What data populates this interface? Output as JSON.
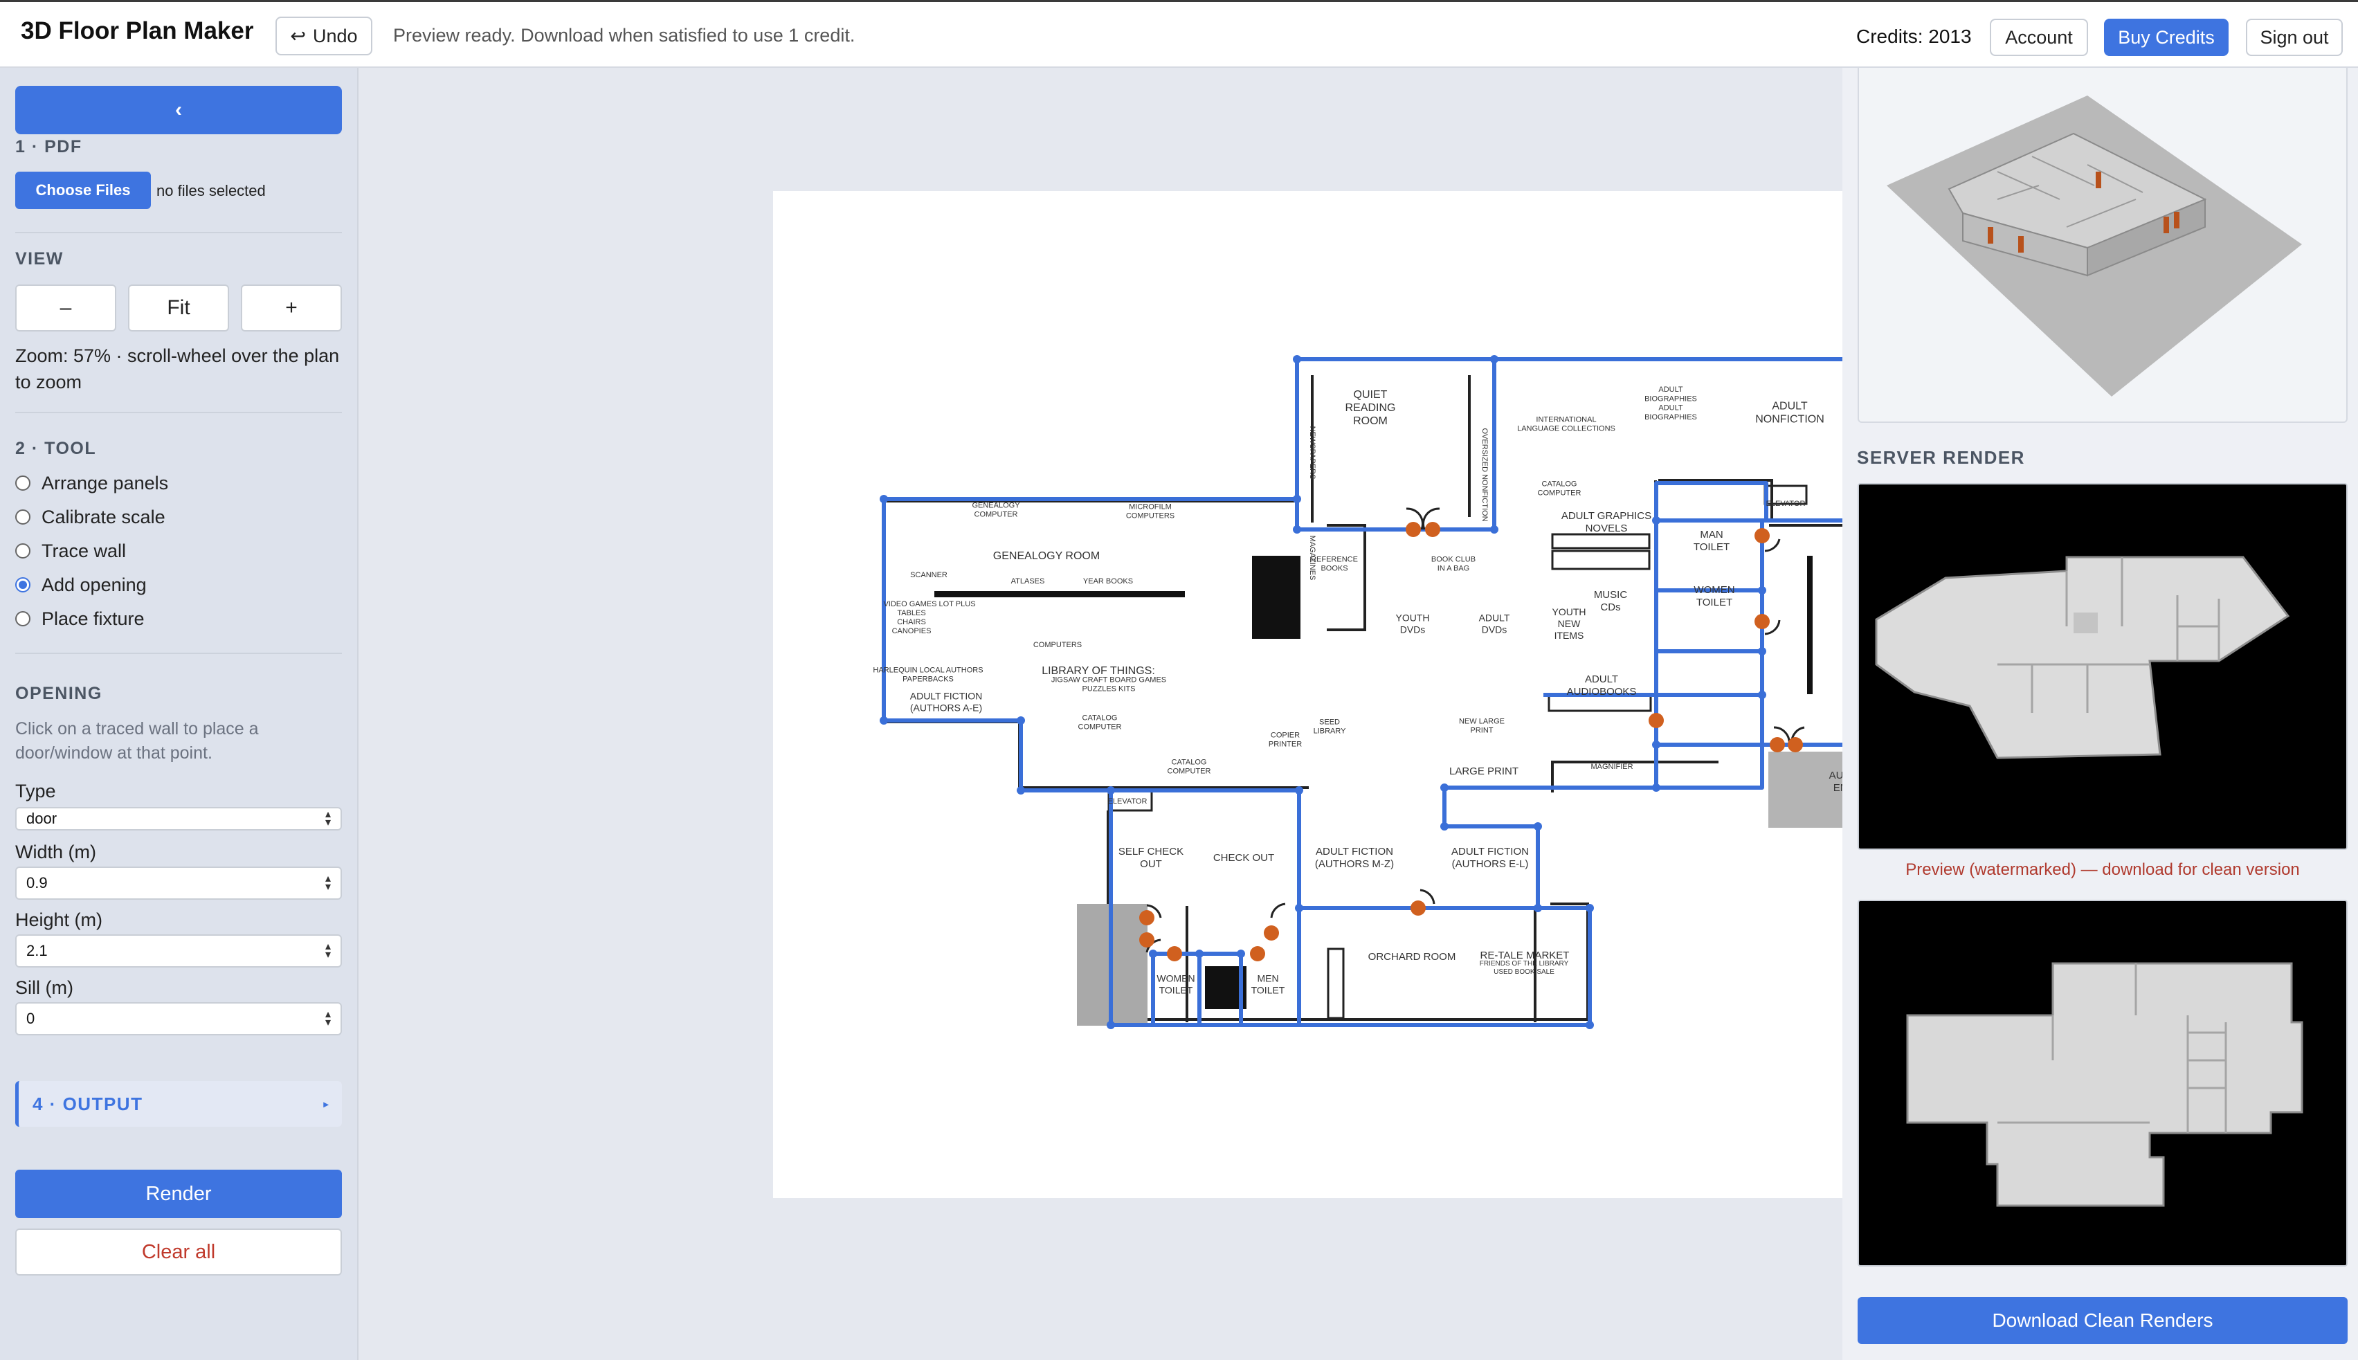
{
  "app": {
    "title": "3D Floor Plan Maker",
    "undo_label": "Undo",
    "status": "Preview ready. Download when satisfied to use 1 credit.",
    "credits": "Credits: 2013",
    "account_label": "Account",
    "buy_label": "Buy Credits",
    "signout_label": "Sign out"
  },
  "sidebar": {
    "collapse_glyph": "‹",
    "pdf_title": "1 · PDF",
    "choose_label": "Choose Files",
    "no_file": "no files selected",
    "view_title": "VIEW",
    "zoom_out": "–",
    "fit": "Fit",
    "zoom_in": "+",
    "zoom_info": "Zoom: 57% · scroll-wheel over the plan to zoom",
    "tool_title": "2 · TOOL",
    "tools": [
      {
        "label": "Arrange panels",
        "selected": false
      },
      {
        "label": "Calibrate scale",
        "selected": false
      },
      {
        "label": "Trace wall",
        "selected": false
      },
      {
        "label": "Add opening",
        "selected": true
      },
      {
        "label": "Place fixture",
        "selected": false
      }
    ],
    "opening_title": "OPENING",
    "opening_hint": "Click on a traced wall to place a door/window at that point.",
    "type_label": "Type",
    "type_value": "door",
    "width_label": "Width (m)",
    "width_value": "0.9",
    "height_label": "Height (m)",
    "height_value": "2.1",
    "sill_label": "Sill (m)",
    "sill_value": "0",
    "output_title": "4 · OUTPUT",
    "render_label": "Render",
    "clear_label": "Clear all"
  },
  "plan": {
    "rooms": [
      {
        "id": "quiet",
        "text": "QUIET\nREADING\nROOM"
      },
      {
        "id": "intl",
        "text": "INTERNATIONAL\nLANGUAGE COLLECTIONS"
      },
      {
        "id": "adult_bio",
        "text": "ADULT\nBIOGRAPHIES\nADULT\nBIOGRAPHIES"
      },
      {
        "id": "adult_nf",
        "text": "ADULT\nNONFICTION"
      },
      {
        "id": "catalog1",
        "text": "CATALOG\nCOMPUTER"
      },
      {
        "id": "maps",
        "text": "MAPS"
      },
      {
        "id": "elevator1",
        "text": "ELEVATOR"
      },
      {
        "id": "genealogy_pc",
        "text": "GENEALOGY\nCOMPUTER"
      },
      {
        "id": "microfilm",
        "text": "MICROFILM\nCOMPUTERS"
      },
      {
        "id": "genealogy",
        "text": "GENEALOGY ROOM"
      },
      {
        "id": "scanner",
        "text": "SCANNER"
      },
      {
        "id": "atlases",
        "text": "ATLASES"
      },
      {
        "id": "yearbooks",
        "text": "YEAR BOOKS"
      },
      {
        "id": "reference",
        "text": "REFERENCE\nBOOKS"
      },
      {
        "id": "bookclub",
        "text": "BOOK CLUB\nIN A BAG"
      },
      {
        "id": "adult_gn",
        "text": "ADULT GRAPHICS\nNOVELS"
      },
      {
        "id": "man_toilet",
        "text": "MAN\nTOILET"
      },
      {
        "id": "women_toilet1",
        "text": "WOMEN\nTOILET"
      },
      {
        "id": "auditorium",
        "text": "AUDITORIUM"
      },
      {
        "id": "music",
        "text": "MUSIC\nCDs"
      },
      {
        "id": "youth_dvd",
        "text": "YOUTH\nDVDs"
      },
      {
        "id": "adult_dvd",
        "text": "ADULT\nDVDs"
      },
      {
        "id": "youth_new",
        "text": "YOUTH\nNEW\nITEMS"
      },
      {
        "id": "adult_audio",
        "text": "ADULT\nAUDIOBOOKS"
      },
      {
        "id": "games",
        "text": "VIDEO GAMES  LOT PLUS"
      },
      {
        "id": "tables",
        "text": "TABLES\nCHAIRS\nCANOPIES"
      },
      {
        "id": "computers",
        "text": "COMPUTERS"
      },
      {
        "id": "library_things",
        "text": "LIBRARY OF THINGS:"
      },
      {
        "id": "things_items",
        "text": "JIGSAW  CRAFT  BOARD GAMES\nPUZZLES  KITS"
      },
      {
        "id": "harlequin",
        "text": "HARLEQUIN  LOCAL AUTHORS\nPAPERBACKS"
      },
      {
        "id": "adult_fic1",
        "text": "ADULT FICTION\n(AUTHORS A-E)"
      },
      {
        "id": "catalog2",
        "text": "CATALOG\nCOMPUTER"
      },
      {
        "id": "seed",
        "text": "SEED\nLIBRARY"
      },
      {
        "id": "copier",
        "text": "COPIER\nPRINTER"
      },
      {
        "id": "new_large",
        "text": "NEW LARGE\nPRINT"
      },
      {
        "id": "magnifier",
        "text": "MAGNIFIER"
      },
      {
        "id": "auditorium_entrance",
        "text": "AUDITORIUM\nENTRANCE"
      },
      {
        "id": "catalog3",
        "text": "CATALOG\nCOMPUTER"
      },
      {
        "id": "large_print",
        "text": "LARGE PRINT"
      },
      {
        "id": "elevator2",
        "text": "ELEVATOR"
      },
      {
        "id": "self_check",
        "text": "SELF CHECK\nOUT"
      },
      {
        "id": "check_out",
        "text": "CHECK OUT"
      },
      {
        "id": "adult_fic2",
        "text": "ADULT FICTION\n(AUTHORS M-Z)"
      },
      {
        "id": "adult_fic3",
        "text": "ADULT FICTION\n(AUTHORS E-L)"
      },
      {
        "id": "women_toilet2",
        "text": "WOMEN\nTOILET"
      },
      {
        "id": "men_toilet",
        "text": "MEN\nTOILET"
      },
      {
        "id": "orchard",
        "text": "ORCHARD ROOM"
      },
      {
        "id": "retale",
        "text": "RE-TALE MARKET"
      },
      {
        "id": "friends",
        "text": "FRIENDS OF THE LIBRARY\nUSED BOOK SALE"
      },
      {
        "id": "newspapers",
        "text": "NEWSPAPERS"
      },
      {
        "id": "magazines",
        "text": "MAGAZINES"
      },
      {
        "id": "oversized",
        "text": "OVERSIZED NONFICTION"
      }
    ]
  },
  "right": {
    "server_title": "SERVER RENDER",
    "watermark_note": "Preview (watermarked) — download for clean version",
    "download_label": "Download Clean Renders"
  },
  "colors": {
    "accent": "#3e74e0",
    "wall": "#3a6fd8",
    "opening": "#d0601f",
    "danger": "#c0392b"
  }
}
